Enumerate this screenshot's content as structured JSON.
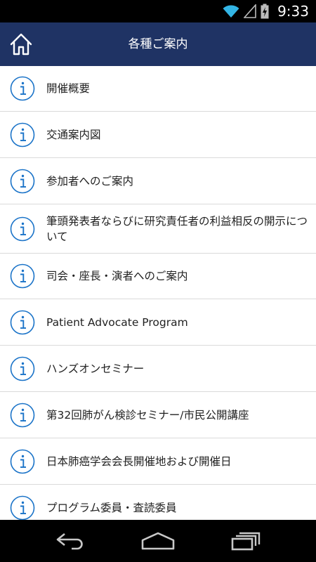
{
  "status_bar": {
    "time": "9:33",
    "icons": [
      "wifi-icon",
      "signal-icon",
      "battery-charging-icon"
    ]
  },
  "header": {
    "title": "各種ご案内",
    "home_icon": "home-icon",
    "background_color": "#1f3364"
  },
  "menu": {
    "icon": "info-icon",
    "icon_color": "#1a73c8",
    "items": [
      {
        "label": "開催概要"
      },
      {
        "label": "交通案内図"
      },
      {
        "label": "参加者へのご案内"
      },
      {
        "label": "筆頭発表者ならびに研究責任者の利益相反の開示について"
      },
      {
        "label": "司会・座長・演者へのご案内"
      },
      {
        "label": "Patient Advocate Program"
      },
      {
        "label": "ハンズオンセミナー"
      },
      {
        "label": "第32回肺がん検診セミナー/市民公開講座"
      },
      {
        "label": "日本肺癌学会会長開催地および開催日"
      },
      {
        "label": "プログラム委員・査読委員"
      }
    ]
  },
  "nav_bar": {
    "buttons": [
      "back-icon",
      "home-icon",
      "recent-apps-icon"
    ]
  }
}
